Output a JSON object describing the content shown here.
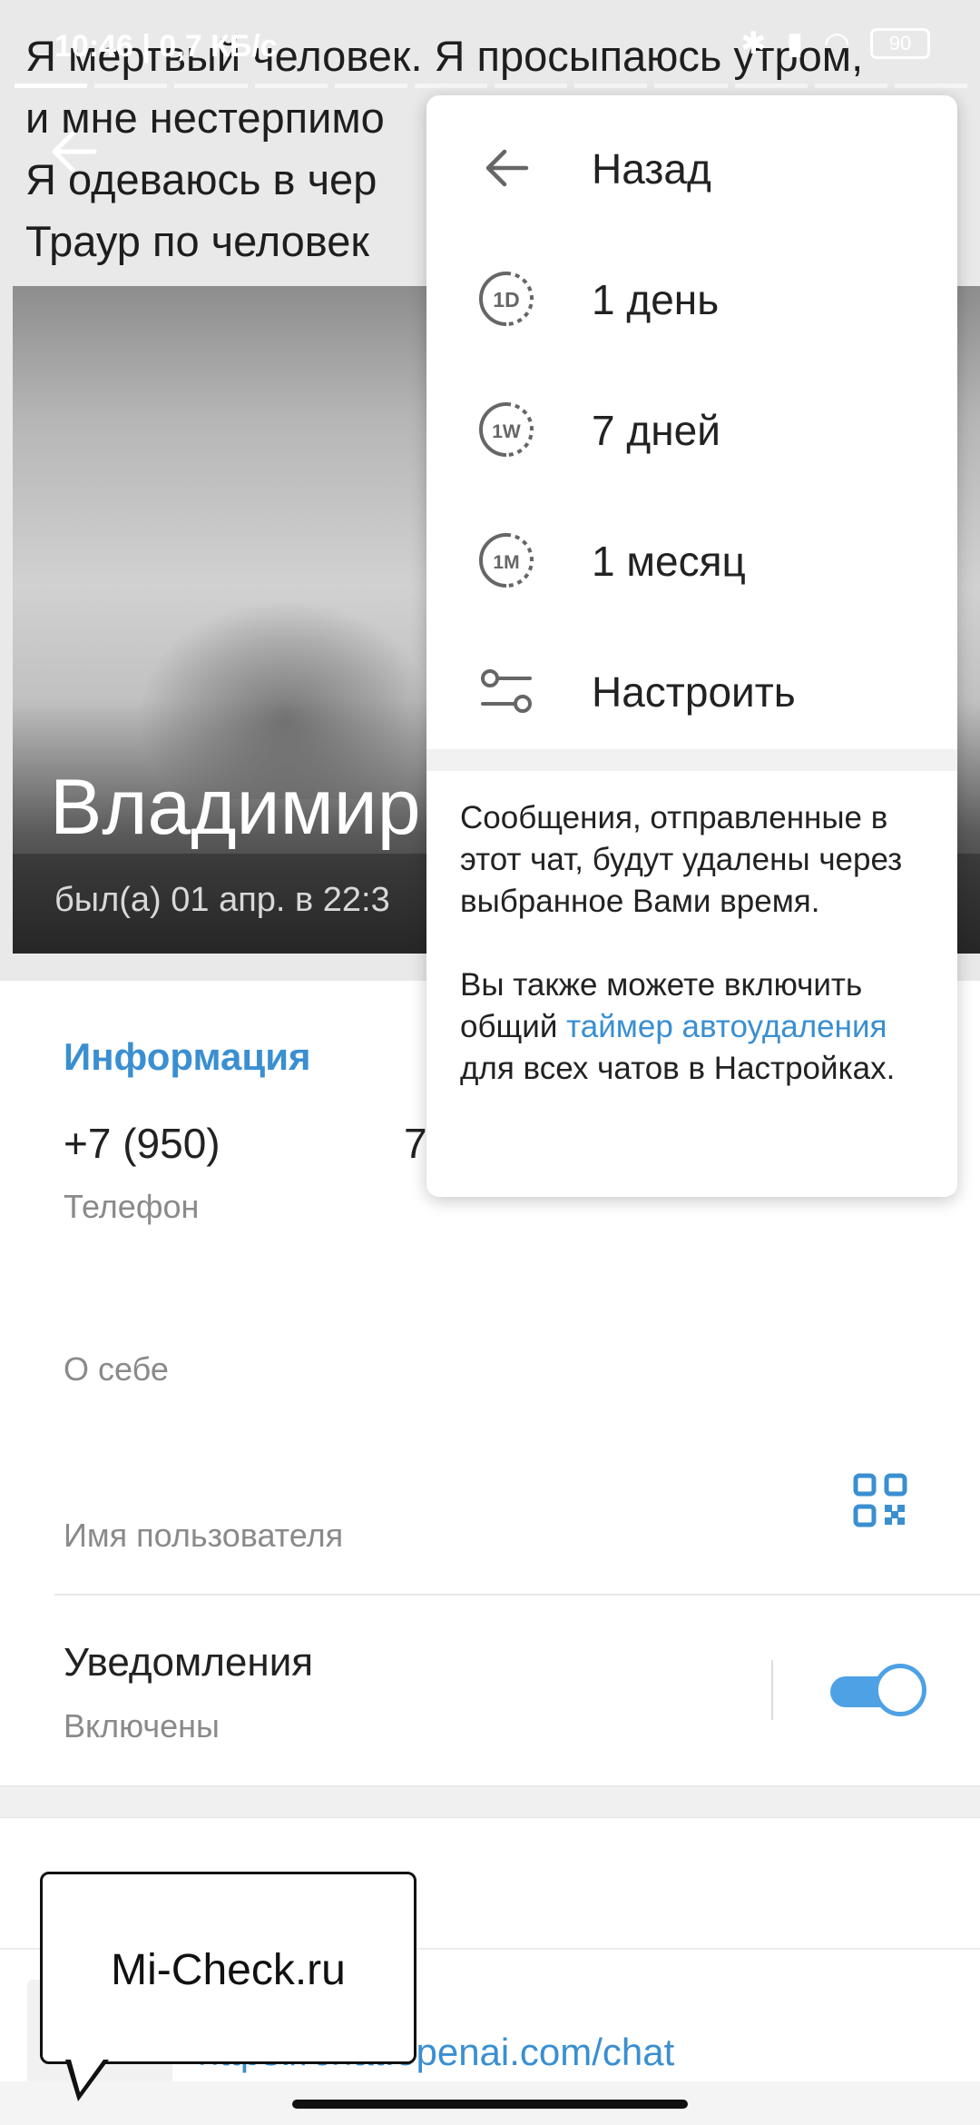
{
  "status_bar": {
    "time_speed": "10:46 | 0,7 КБ/с",
    "battery": "90"
  },
  "story": {
    "text": "Я мертвый человек. Я просыпаюсь утром,\nи мне нестерпимо\nЯ одеваюсь в чер\nТраур по человек"
  },
  "profile": {
    "name": "Владимир",
    "last_seen": "был(а) 01 апр. в 22:3"
  },
  "info": {
    "section_title": "Информация",
    "phone_value": "+7 (950)",
    "phone_suffix": "7",
    "phone_label": "Телефон",
    "about_label": "О себе",
    "username_label": "Имя пользователя"
  },
  "notifications": {
    "title": "Уведомления",
    "status": "Включены",
    "enabled": true,
    "accent_color": "#4ea1e4"
  },
  "shared_link": "https://chat.openai.com/chat",
  "menu": {
    "items": [
      {
        "label": "Назад",
        "icon": "back-arrow-icon"
      },
      {
        "label": "1 день",
        "icon": "timer-1d-icon"
      },
      {
        "label": "7 дней",
        "icon": "timer-1w-icon"
      },
      {
        "label": "1 месяц",
        "icon": "timer-1m-icon"
      },
      {
        "label": "Настроить",
        "icon": "sliders-icon"
      }
    ],
    "info_p1": "Сообщения, отправленные в этот чат, будут удалены через выбранное Вами время.",
    "info_p2_before": "Вы также можете включить общий ",
    "info_p2_link": "таймер автоудаления",
    "info_p2_after": " для всех чатов в Настройках."
  },
  "watermark": "Mi-Check.ru"
}
